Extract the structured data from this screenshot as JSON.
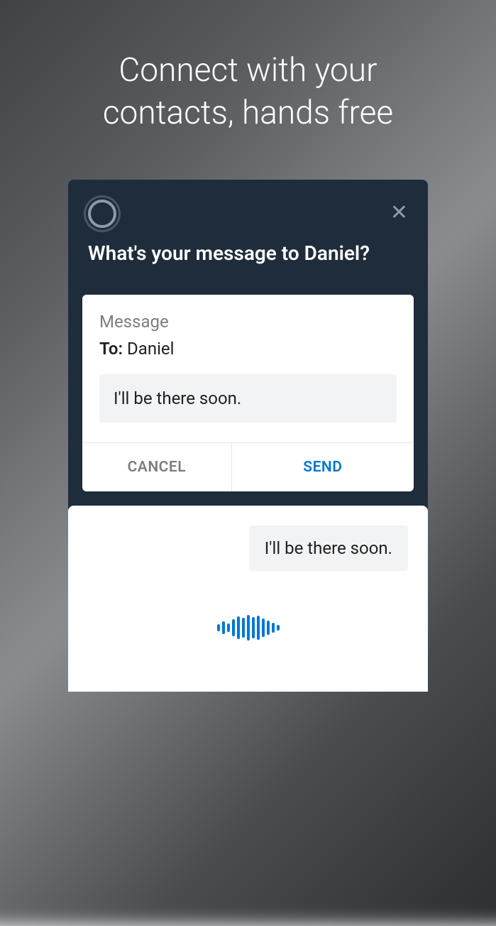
{
  "header": {
    "title": "Connect with your\ncontacts, hands free"
  },
  "assistant": {
    "prompt": "What's your message to Daniel?"
  },
  "message": {
    "label": "Message",
    "toLabel": "To:",
    "recipient": "Daniel",
    "body": "I'll be there soon."
  },
  "actions": {
    "cancel": "CANCEL",
    "send": "SEND"
  },
  "response": {
    "text": "I'll be there soon."
  }
}
